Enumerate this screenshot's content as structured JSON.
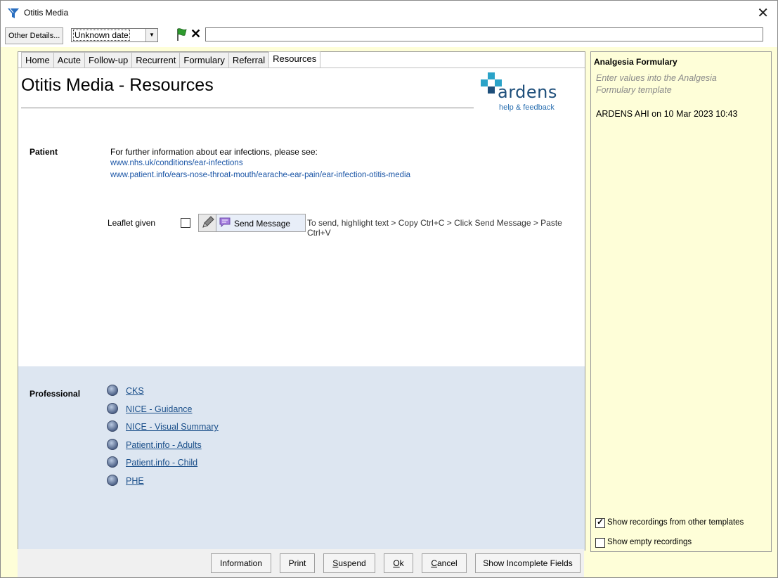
{
  "window": {
    "title": "Otitis Media",
    "close_glyph": "✕"
  },
  "toolbar": {
    "other_details_label": "Other Details...",
    "date_value": "Unknown date",
    "date_arrow": "▼",
    "flag_icon": "green-flag-icon",
    "clear_glyph": "✕",
    "input_value": ""
  },
  "tabs": [
    {
      "label": "Home",
      "active": false
    },
    {
      "label": "Acute",
      "active": false
    },
    {
      "label": "Follow-up",
      "active": false
    },
    {
      "label": "Recurrent",
      "active": false
    },
    {
      "label": "Formulary",
      "active": false
    },
    {
      "label": "Referral",
      "active": false
    },
    {
      "label": "Resources",
      "active": true
    }
  ],
  "page": {
    "title": "Otitis Media - Resources",
    "logo_text": "ardens",
    "logo_help": "help & feedback"
  },
  "patient": {
    "label": "Patient",
    "info": "For further information about ear infections, please see:",
    "links": [
      "www.nhs.uk/conditions/ear-infections",
      "www.patient.info/ears-nose-throat-mouth/earache-ear-pain/ear-infection-otitis-media"
    ],
    "leaflet_label": "Leaflet given",
    "leaflet_checked": false,
    "send_message_label": "Send Message",
    "instructions": "To send, highlight text > Copy Ctrl+C > Click Send Message > Paste Ctrl+V"
  },
  "professional": {
    "label": "Professional",
    "links": [
      "CKS",
      "NICE - Guidance",
      "NICE - Visual Summary",
      "Patient.info - Adults",
      "Patient.info - Child",
      "PHE"
    ]
  },
  "bottom_buttons": {
    "information": "Information",
    "print": "Print",
    "suspend_u": "S",
    "suspend_rest": "uspend",
    "ok_u": "O",
    "ok_rest": "k",
    "cancel_u": "C",
    "cancel_rest": "ancel",
    "show_incomplete": "Show Incomplete Fields"
  },
  "right_panel": {
    "title": "Analgesia Formulary",
    "hint": "Enter values into the Analgesia Formulary template",
    "record": "ARDENS AHI on 10 Mar 2023 10:43",
    "show_other_label": "Show recordings from other templates",
    "show_other_checked": true,
    "show_empty_label": "Show empty recordings",
    "show_empty_checked": false
  },
  "colors": {
    "panel_bg": "#fefed8",
    "professional_bg": "#dde6f1",
    "link": "#1a55a6",
    "logo_blue": "#1d4e7a",
    "logo_cross": "#2aa3c8"
  }
}
